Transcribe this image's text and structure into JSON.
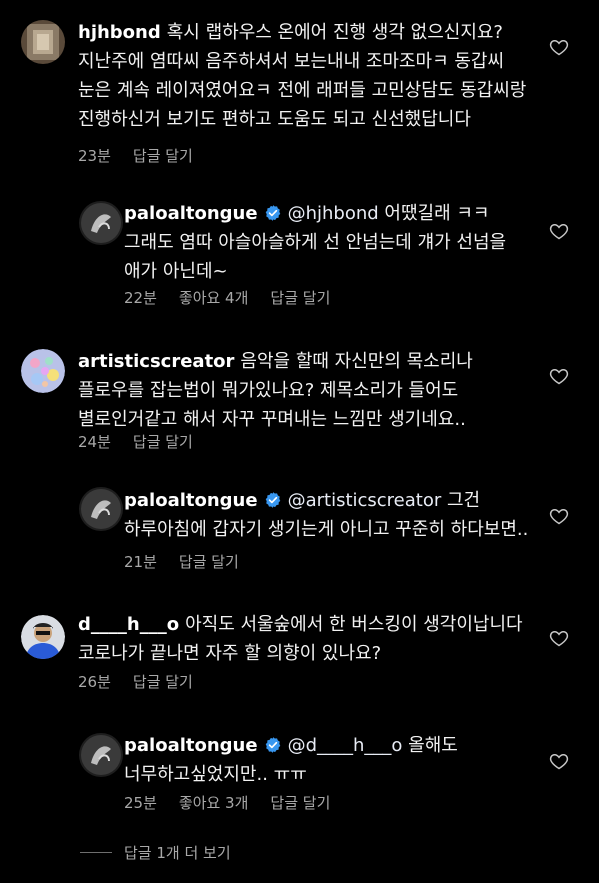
{
  "comments": [
    {
      "username": "hjhbond",
      "text": "혹시 랩하우스 온에어 진행 생각 없으신지요? 지난주에 염따씨 음주하셔서 보는내내 조마조마ㅋ 동갑씨 눈은 계속 레이져였어요ㅋ 전에 래퍼들 고민상담도 동갑씨랑 진행하신거 보기도 편하고 도움도 되고 신선했답니다",
      "time": "23분",
      "reply": "답글 달기",
      "likes": ""
    },
    {
      "username": "paloaltongue",
      "verified": true,
      "mention": "@hjhbond",
      "text": "어땠길래 ㅋㅋ 그래도 염따 아슬아슬하게 선 안넘는데 걔가 선넘을 애가 아닌데~",
      "time": "22분",
      "likes": "좋아요 4개",
      "reply": "답글 달기"
    },
    {
      "username": "artisticscreator",
      "text": "음악을 할때 자신만의 목소리나 플로우를 잡는법이 뭐가있나요? 제목소리가 들어도 별로인거같고 해서 자꾸 꾸며내는 느낌만 생기네요..",
      "time": "24분",
      "reply": "답글 달기",
      "likes": ""
    },
    {
      "username": "paloaltongue",
      "verified": true,
      "mention": "@artisticscreator",
      "text": "그건 하루아침에 갑자기 생기는게 아니고 꾸준히 하다보면..",
      "time": "21분",
      "reply": "답글 달기",
      "likes": ""
    },
    {
      "username": "d____h___o",
      "text": "아직도 서울숲에서 한 버스킹이 생각이납니다 코로나가 끝나면 자주 할 의향이 있나요?",
      "time": "26분",
      "reply": "답글 달기",
      "likes": ""
    },
    {
      "username": "paloaltongue",
      "verified": true,
      "mention": "@d____h___o",
      "text": "올해도 너무하고싶었지만.. ㅠㅠ",
      "time": "25분",
      "likes": "좋아요 3개",
      "reply": "답글 달기"
    }
  ],
  "view_more": "답글 1개 더 보기",
  "colors": {
    "background": "#000000",
    "text": "#f5f5f5",
    "meta": "#a8a8a8",
    "verified": "#3897f0"
  }
}
